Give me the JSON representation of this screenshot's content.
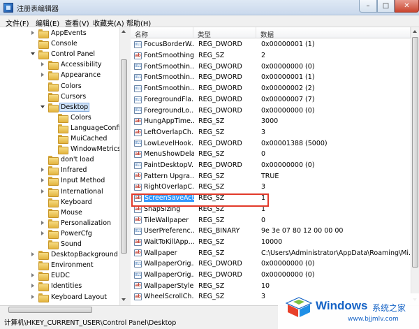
{
  "window": {
    "title": "注册表编辑器",
    "min": "–",
    "max": "□",
    "close": "✕"
  },
  "menu": [
    "文件(F)",
    "编辑(E)",
    "查看(V)",
    "收藏夹(A)",
    "帮助(H)"
  ],
  "tree": [
    {
      "label": "AppEvents",
      "indent": 0,
      "expander": "collapsed"
    },
    {
      "label": "Console",
      "indent": 0,
      "expander": "none"
    },
    {
      "label": "Control Panel",
      "indent": 0,
      "expander": "expanded"
    },
    {
      "label": "Accessibility",
      "indent": 1,
      "expander": "collapsed"
    },
    {
      "label": "Appearance",
      "indent": 1,
      "expander": "collapsed"
    },
    {
      "label": "Colors",
      "indent": 1,
      "expander": "none"
    },
    {
      "label": "Cursors",
      "indent": 1,
      "expander": "none"
    },
    {
      "label": "Desktop",
      "indent": 1,
      "expander": "expanded",
      "selected": true
    },
    {
      "label": "Colors",
      "indent": 2,
      "expander": "none"
    },
    {
      "label": "LanguageConfig",
      "indent": 2,
      "expander": "none"
    },
    {
      "label": "MuiCached",
      "indent": 2,
      "expander": "none"
    },
    {
      "label": "WindowMetrics",
      "indent": 2,
      "expander": "none"
    },
    {
      "label": "don't load",
      "indent": 1,
      "expander": "none"
    },
    {
      "label": "Infrared",
      "indent": 1,
      "expander": "collapsed"
    },
    {
      "label": "Input Method",
      "indent": 1,
      "expander": "collapsed"
    },
    {
      "label": "International",
      "indent": 1,
      "expander": "collapsed"
    },
    {
      "label": "Keyboard",
      "indent": 1,
      "expander": "none"
    },
    {
      "label": "Mouse",
      "indent": 1,
      "expander": "none"
    },
    {
      "label": "Personalization",
      "indent": 1,
      "expander": "collapsed"
    },
    {
      "label": "PowerCfg",
      "indent": 1,
      "expander": "collapsed"
    },
    {
      "label": "Sound",
      "indent": 1,
      "expander": "none"
    },
    {
      "label": "DesktopBackground",
      "indent": 0,
      "expander": "collapsed"
    },
    {
      "label": "Environment",
      "indent": 0,
      "expander": "none"
    },
    {
      "label": "EUDC",
      "indent": 0,
      "expander": "collapsed"
    },
    {
      "label": "Identities",
      "indent": 0,
      "expander": "collapsed"
    },
    {
      "label": "Keyboard Layout",
      "indent": 0,
      "expander": "collapsed"
    }
  ],
  "columns": {
    "name": "名称",
    "type": "类型",
    "data": "数据"
  },
  "values": [
    {
      "name": "FocusBorderW...",
      "type": "REG_DWORD",
      "data": "0x00000001 (1)"
    },
    {
      "name": "FontSmoothing",
      "type": "REG_SZ",
      "data": "2"
    },
    {
      "name": "FontSmoothin...",
      "type": "REG_DWORD",
      "data": "0x00000000 (0)"
    },
    {
      "name": "FontSmoothin...",
      "type": "REG_DWORD",
      "data": "0x00000001 (1)"
    },
    {
      "name": "FontSmoothin...",
      "type": "REG_DWORD",
      "data": "0x00000002 (2)"
    },
    {
      "name": "ForegroundFla...",
      "type": "REG_DWORD",
      "data": "0x00000007 (7)"
    },
    {
      "name": "ForegroundLo...",
      "type": "REG_DWORD",
      "data": "0x00000000 (0)"
    },
    {
      "name": "HungAppTime...",
      "type": "REG_SZ",
      "data": "3000"
    },
    {
      "name": "LeftOverlapCh...",
      "type": "REG_SZ",
      "data": "3"
    },
    {
      "name": "LowLevelHook...",
      "type": "REG_DWORD",
      "data": "0x00001388 (5000)"
    },
    {
      "name": "MenuShowDelay",
      "type": "REG_SZ",
      "data": "0"
    },
    {
      "name": "PaintDesktopV...",
      "type": "REG_DWORD",
      "data": "0x00000000 (0)"
    },
    {
      "name": "Pattern Upgra...",
      "type": "REG_SZ",
      "data": "TRUE"
    },
    {
      "name": "RightOverlapC...",
      "type": "REG_SZ",
      "data": "3"
    },
    {
      "name": "ScreenSaveActi...",
      "type": "REG_SZ",
      "data": "1",
      "selected": true
    },
    {
      "name": "SnapSizing",
      "type": "REG_SZ",
      "data": "1"
    },
    {
      "name": "TileWallpaper",
      "type": "REG_SZ",
      "data": "0"
    },
    {
      "name": "UserPreferenc...",
      "type": "REG_BINARY",
      "data": "9e 3e 07 80 12 00 00 00"
    },
    {
      "name": "WaitToKillApp...",
      "type": "REG_SZ",
      "data": "10000"
    },
    {
      "name": "Wallpaper",
      "type": "REG_SZ",
      "data": "C:\\Users\\Administrator\\AppData\\Roaming\\Mi..."
    },
    {
      "name": "WallpaperOrig...",
      "type": "REG_DWORD",
      "data": "0x00000000 (0)"
    },
    {
      "name": "WallpaperOrig...",
      "type": "REG_DWORD",
      "data": "0x00000000 (0)"
    },
    {
      "name": "WallpaperStyle",
      "type": "REG_SZ",
      "data": "10"
    },
    {
      "name": "WheelScrollCh...",
      "type": "REG_SZ",
      "data": "3"
    }
  ],
  "status": {
    "path": "计算机\\HKEY_CURRENT_USER\\Control Panel\\Desktop"
  },
  "watermark": {
    "title": "Windows",
    "subtitle": "系统之家",
    "url": "www.bjjmlv.com"
  },
  "colors": {
    "selection": "#3399ff",
    "highlight_box": "#e23a2a",
    "brand_blue": "#1563c6"
  }
}
